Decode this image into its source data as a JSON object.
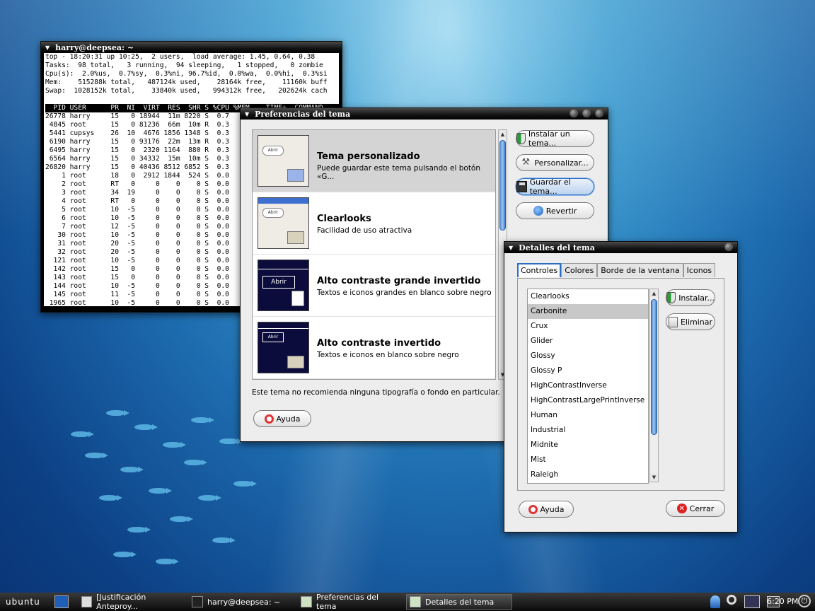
{
  "terminal": {
    "title": "harry@deepsea: ~",
    "lines": [
      "top - 18:20:31 up 10:25,  2 users,  load average: 1.45, 0.64, 0.38",
      "Tasks:  98 total,   3 running,  94 sleeping,   1 stopped,   0 zombie",
      "Cpu(s):  2.0%us,  0.7%sy,  0.3%ni, 96.7%id,  0.0%wa,  0.0%hi,  0.3%si",
      "Mem:    515288k total,   487124k used,    28164k free,    11160k buff",
      "Swap:  1028152k total,    33840k used,   994312k free,   202624k cach",
      ""
    ],
    "header": "  PID USER      PR  NI  VIRT  RES  SHR S %CPU %MEM    TIME+  COMMAND",
    "rows": [
      "26778 harry     15   0 18944  11m 8220 S  0.7",
      " 4845 root      15   0 81236  66m  10m R  0.3",
      " 5441 cupsys    26  10  4676 1856 1348 S  0.3",
      " 6190 harry     15   0 93176  22m  13m R  0.3",
      " 6495 harry     15   0  2320 1164  880 R  0.3",
      " 6564 harry     15   0 34332  15m  10m S  0.3",
      "26820 harry     15   0 40436 8512 6852 S  0.3",
      "    1 root      18   0  2912 1844  524 S  0.0",
      "    2 root      RT   0     0    0    0 S  0.0",
      "    3 root      34  19     0    0    0 S  0.0",
      "    4 root      RT   0     0    0    0 S  0.0",
      "    5 root      10  -5     0    0    0 S  0.0",
      "    6 root      10  -5     0    0    0 S  0.0",
      "    7 root      12  -5     0    0    0 S  0.0",
      "   30 root      10  -5     0    0    0 S  0.0",
      "   31 root      20  -5     0    0    0 S  0.0",
      "   32 root      20  -5     0    0    0 S  0.0",
      "  121 root      10  -5     0    0    0 S  0.0",
      "  142 root      15   0     0    0    0 S  0.0",
      "  143 root      15   0     0    0    0 S  0.0",
      "  144 root      10  -5     0    0    0 S  0.0",
      "  145 root      11  -5     0    0    0 S  0.0",
      " 1965 root      10  -5     0    0    0 S  0.0"
    ]
  },
  "prefs": {
    "title": "Preferencias del tema",
    "themes": [
      {
        "name": "Tema personalizado",
        "desc": "Puede guardar este tema pulsando el botón «G...",
        "thumb_label": "Abrir"
      },
      {
        "name": "Clearlooks",
        "desc": "Facilidad de uso atractiva",
        "thumb_label": "Abrir"
      },
      {
        "name": "Alto contraste grande invertido",
        "desc": "Textos e iconos grandes en blanco sobre negro",
        "thumb_label": "Abrir"
      },
      {
        "name": "Alto contraste invertido",
        "desc": "Textos e iconos en blanco sobre negro",
        "thumb_label": "Abrir"
      }
    ],
    "buttons": {
      "install": "Instalar un tema...",
      "customize": "Personalizar...",
      "save": "Guardar el tema...",
      "revert": "Revertir",
      "help": "Ayuda"
    },
    "note": "Este tema no recomienda ninguna tipografía o fondo en particular."
  },
  "details": {
    "title": "Detalles del tema",
    "tabs": [
      "Controles",
      "Colores",
      "Borde de la ventana",
      "Iconos"
    ],
    "themes": [
      "Clearlooks",
      "Carbonite",
      "Crux",
      "Glider",
      "Glossy",
      "Glossy P",
      "HighContrastInverse",
      "HighContrastLargePrintInverse",
      "Human",
      "Industrial",
      "Midnite",
      "Mist",
      "Raleigh"
    ],
    "selected_index": 1,
    "buttons": {
      "install": "Instalar...",
      "remove": "Eliminar",
      "help": "Ayuda",
      "close": "Cerrar"
    }
  },
  "taskbar": {
    "logo": "ubuntu",
    "tasks": [
      "[Justificación Anteproy...",
      "harry@deepsea: ~",
      "Preferencias del tema",
      "Detalles del tema"
    ],
    "clock": "6:20 PM"
  }
}
